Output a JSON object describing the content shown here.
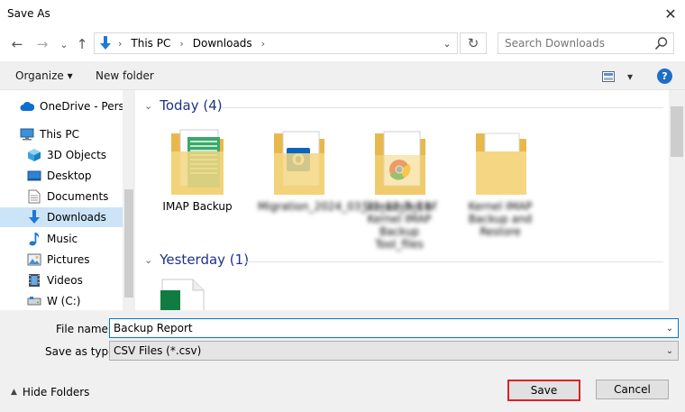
{
  "window": {
    "title": "Save As",
    "close_glyph": "✕"
  },
  "nav": {
    "back_glyph": "←",
    "forward_glyph": "→",
    "recent_glyph": "⌄",
    "up_glyph": "↑",
    "address": [
      "This PC",
      "Downloads"
    ],
    "sep_glyph": "›",
    "address_dd_glyph": "⌄",
    "refresh_glyph": "↻",
    "search_placeholder": "Search Downloads"
  },
  "toolbar": {
    "organize_label": "Organize ▾",
    "new_folder_label": "New folder",
    "view_dd_glyph": "▾",
    "help_label": "?"
  },
  "sidebar": {
    "items": [
      {
        "label": "OneDrive - Persor",
        "icon": "cloud-icon"
      },
      {
        "label": "This PC",
        "icon": "computer-icon"
      },
      {
        "label": "3D Objects",
        "icon": "cube-icon"
      },
      {
        "label": "Desktop",
        "icon": "desktop-icon"
      },
      {
        "label": "Documents",
        "icon": "document-icon"
      },
      {
        "label": "Downloads",
        "icon": "download-icon",
        "selected": true
      },
      {
        "label": "Music",
        "icon": "music-icon"
      },
      {
        "label": "Pictures",
        "icon": "picture-icon"
      },
      {
        "label": "Videos",
        "icon": "video-icon"
      },
      {
        "label": "W (C:)",
        "icon": "drive-icon"
      }
    ]
  },
  "content": {
    "groups": [
      {
        "label": "Today (4)",
        "chev": "⌄"
      },
      {
        "label": "Yesterday (1)",
        "chev": "⌄"
      }
    ],
    "files": [
      {
        "label": "IMAP Backup",
        "blurred": false,
        "icon": "folder-spreadsheet-icon"
      },
      {
        "label": "Migration_2024_03_31_12_3_18",
        "blurred": true,
        "icon": "folder-outlook-icon"
      },
      {
        "label": "Screenshot of Kernel IMAP Backup Tool_files",
        "blurred": true,
        "icon": "folder-chrome-icon"
      },
      {
        "label": "Kernel IMAP Backup and Restore",
        "blurred": true,
        "icon": "folder-icon"
      }
    ]
  },
  "form": {
    "file_name_label": "File name:",
    "file_name_value": "Backup Report",
    "save_type_label": "Save as type:",
    "save_type_value": "CSV Files (*.csv)",
    "dd_glyph": "⌄",
    "hide_folders_label": "Hide Folders",
    "hide_glyph": "▲",
    "save_label": "Save",
    "cancel_label": "Cancel"
  },
  "colors": {
    "accent": "#0078d7",
    "selected": "#cce4f7",
    "group_header": "#1e3287",
    "save_highlight": "#d9232a"
  }
}
